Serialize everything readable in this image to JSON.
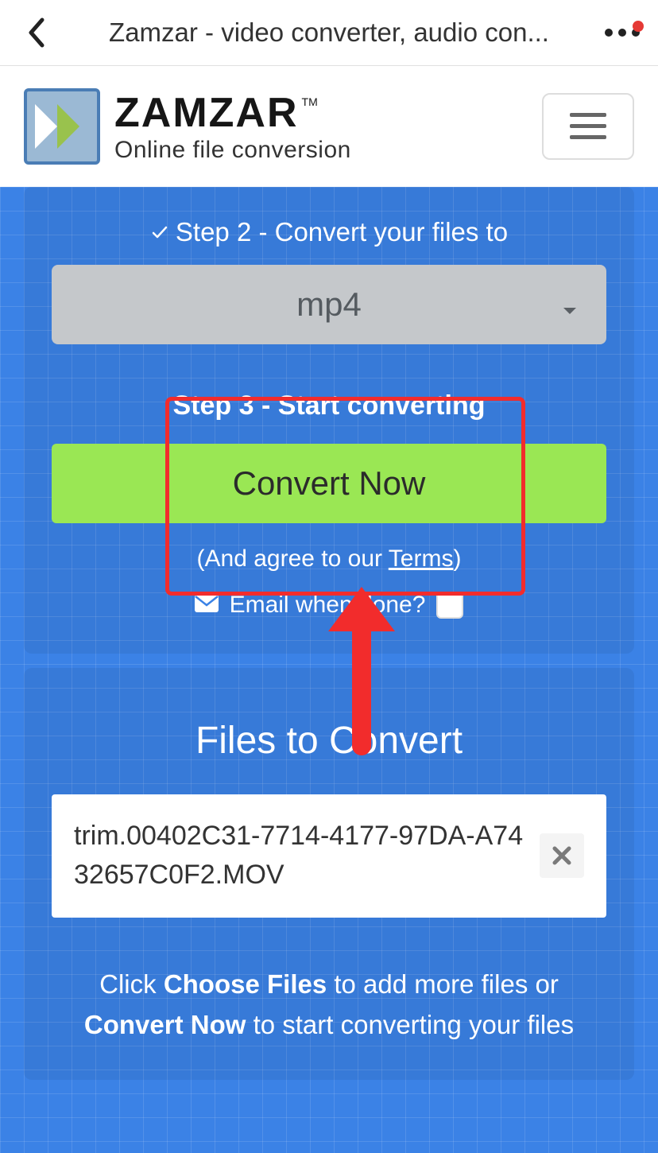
{
  "browser": {
    "title": "Zamzar - video converter, audio con..."
  },
  "brand": {
    "name": "ZAMZAR",
    "tm": "TM",
    "tagline": "Online file conversion"
  },
  "step2": {
    "label": "Step 2 - Convert your files to",
    "selected": "mp4"
  },
  "step3": {
    "label": "Step 3 - Start converting",
    "button": "Convert Now",
    "terms_pre": "(And agree to our ",
    "terms_link": "Terms",
    "terms_post": ")",
    "email_label": "Email when done?"
  },
  "files": {
    "heading": "Files to Convert",
    "items": [
      {
        "name": "trim.00402C31-7714-4177-97DA-A7432657C0F2.MOV"
      }
    ],
    "hint_parts": {
      "p1": "Click ",
      "b1": "Choose Files",
      "p2": " to add more files or ",
      "b2": "Convert Now",
      "p3": " to start converting your files"
    }
  }
}
